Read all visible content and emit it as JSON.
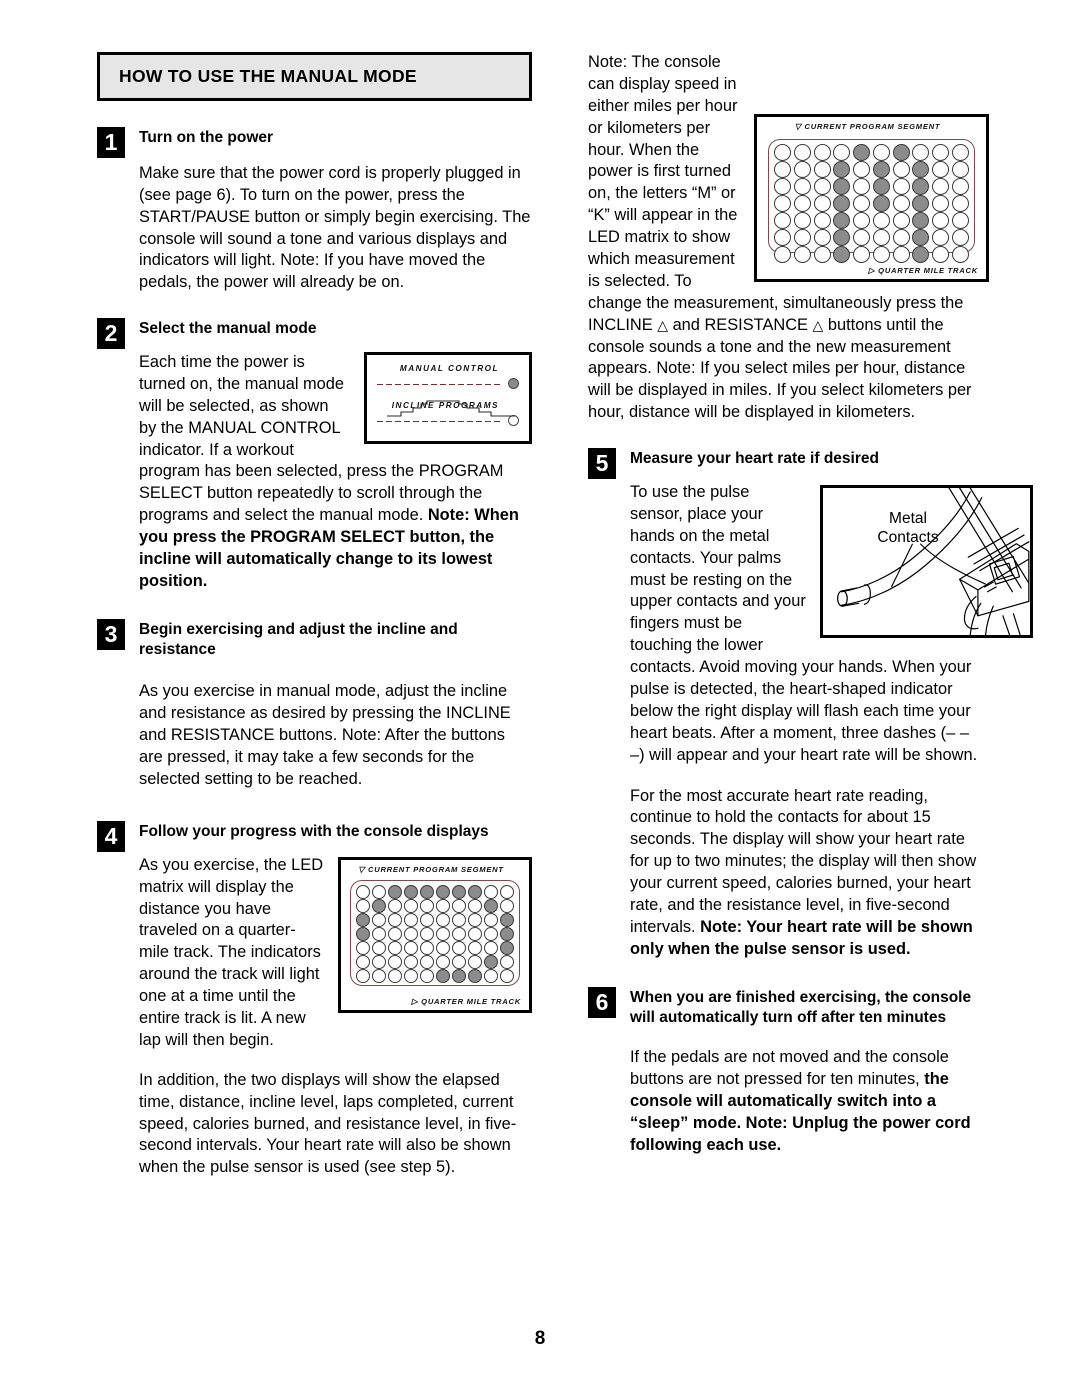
{
  "page": {
    "number": "8"
  },
  "section": {
    "title": "HOW TO USE THE MANUAL MODE"
  },
  "steps": [
    {
      "num": "1",
      "heading": "Turn on the power",
      "body": "Make sure that the power cord is properly plugged in (see page 6). To turn on the power, press the START/PAUSE button or simply begin exercising. The console will sound a tone and various displays and indicators will light. Note: If you have moved the pedals, the power will already be on."
    },
    {
      "num": "2",
      "heading": "Select the manual mode",
      "body_a": "Each time the power is turned on, the manual mode will be selected, as shown by the MANUAL CONTROL indicator. If a workout program has been selected, press the PROGRAM SELECT button repeatedly to scroll through the programs and select the manual mode. ",
      "body_bold": "Note: When you press the PROGRAM SELECT button, the incline will automatically change to its lowest position."
    },
    {
      "num": "3",
      "heading": "Begin exercising and adjust the incline and resistance",
      "body": "As you exercise in manual mode, adjust the incline and resistance as desired by pressing the INCLINE and RESISTANCE buttons. Note: After the buttons are pressed, it may take a few seconds for the selected setting to be reached."
    },
    {
      "num": "4",
      "heading": "Follow your progress with the console displays",
      "body_a": "As you exercise, the LED matrix will display the distance you have traveled on a quarter-mile track. The indicators around the track will light one at a time until the entire track is lit. A new lap will then begin.",
      "body_b": "In addition, the two displays will show the elapsed time, distance, incline level, laps completed, current speed, calories burned, and resistance level, in five-second intervals. Your heart rate will also be shown when the pulse sensor is used (see step 5)."
    },
    {
      "num": "5",
      "heading": "Measure your heart rate if desired",
      "body_a": "To use the pulse sensor, place your hands on the metal contacts. Your palms must be resting on the upper contacts and your fingers must be touching the lower contacts. Avoid moving your hands. When your pulse is detected, the heart-shaped indicator below the right display will flash each time your heart beats. After a moment, three dashes (– – –) will appear and your heart rate will be shown.",
      "body_b_plain": "For the most accurate heart rate reading, continue to hold the contacts for about 15 seconds. The display will show your heart rate for up to two minutes; the display will then show your current speed, calories burned, your heart rate, and the resistance level, in five-second intervals. ",
      "body_b_bold": "Note: Your heart rate will be shown only when the pulse sensor is used."
    },
    {
      "num": "6",
      "heading": "When you are finished exercising, the console will automatically turn off after ten minutes",
      "body_plain": "If the pedals are not moved and the console buttons are not pressed for ten minutes, ",
      "body_bold": "the console will automatically switch into a “sleep” mode. Note: Unplug the power cord following each use."
    }
  ],
  "right_column": {
    "note_intro_plain_a": "Note: The console can display speed in either miles per hour or kilometers per hour. When the power is first turned on, the letters “M” or “K” will appear in the LED matrix to show which measurement is selected. To change the measurement, simultaneously press the INCLINE ",
    "note_tri_1": "△",
    "note_mid": " and RESISTANCE ",
    "note_tri_2": "△",
    "note_intro_plain_b": " buttons until the console sounds a tone and the new measurement appears. Note: If you select miles per hour, distance will be displayed in miles. If you select kilometers per hour, distance will be displayed in kilometers."
  },
  "figures": {
    "manual_control_panel": {
      "label_manual": "MANUAL CONTROL",
      "label_incline": "INCLINE PROGRAMS",
      "manual_indicator_state": "filled",
      "incline_indicator_state": "empty"
    },
    "led_matrix_m": {
      "caption_top": "CURRENT PROGRAM SEGMENT",
      "caption_bottom": "QUARTER MILE TRACK",
      "marker_top": "▽",
      "marker_bottom": "▷",
      "rows": 7,
      "cols": 10,
      "on_cells": [
        [
          0,
          4
        ],
        [
          0,
          6
        ],
        [
          1,
          3
        ],
        [
          1,
          5
        ],
        [
          1,
          7
        ],
        [
          2,
          3
        ],
        [
          2,
          5
        ],
        [
          2,
          7
        ],
        [
          3,
          3
        ],
        [
          3,
          5
        ],
        [
          3,
          7
        ],
        [
          4,
          3
        ],
        [
          4,
          7
        ],
        [
          5,
          3
        ],
        [
          5,
          7
        ],
        [
          6,
          3
        ],
        [
          6,
          7
        ]
      ]
    },
    "led_matrix_track": {
      "caption_top": "CURRENT PROGRAM SEGMENT",
      "caption_bottom": "QUARTER MILE TRACK",
      "marker_top": "▽",
      "marker_bottom": "▷",
      "rows": 7,
      "cols": 10,
      "on_cells": [
        [
          0,
          2
        ],
        [
          0,
          3
        ],
        [
          0,
          4
        ],
        [
          0,
          5
        ],
        [
          0,
          6
        ],
        [
          0,
          7
        ],
        [
          1,
          1
        ],
        [
          1,
          8
        ],
        [
          2,
          0
        ],
        [
          2,
          9
        ],
        [
          3,
          0
        ],
        [
          3,
          9
        ],
        [
          4,
          9
        ],
        [
          5,
          8
        ],
        [
          6,
          5
        ],
        [
          6,
          6
        ],
        [
          6,
          7
        ]
      ]
    },
    "metal_contacts": {
      "label_line1": "Metal",
      "label_line2": "Contacts"
    }
  },
  "colors": {
    "title_bar_bg": "#e6e6e6",
    "led_on": "#8c8c8c",
    "led_border": "#3a3a3a",
    "panel_accent": "#7b4a4a"
  }
}
